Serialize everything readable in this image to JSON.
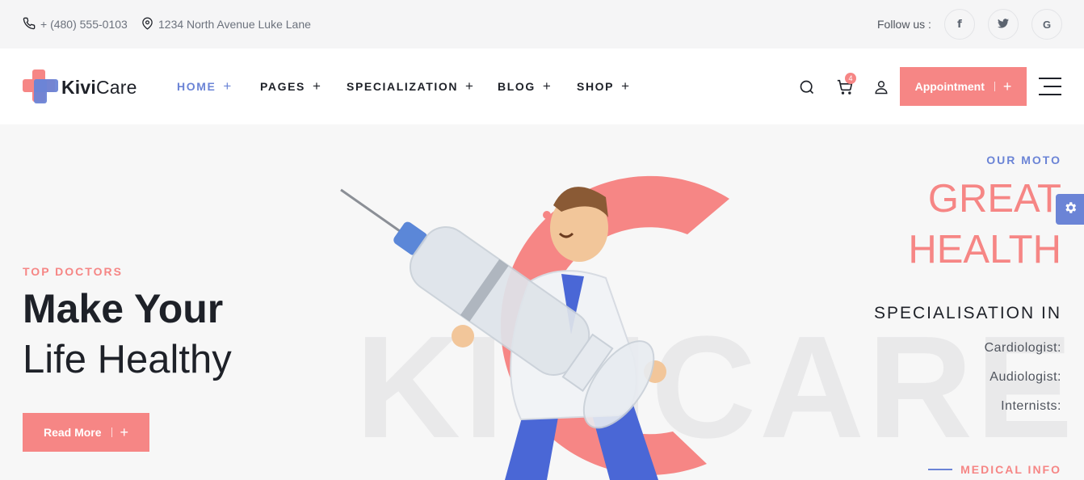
{
  "topbar": {
    "phone": "+ (480) 555-0103",
    "address": "1234 North Avenue Luke Lane",
    "follow_label": "Follow us :",
    "social": [
      {
        "icon": "facebook-icon",
        "glyph": "f"
      },
      {
        "icon": "twitter-icon",
        "glyph": "t"
      },
      {
        "icon": "google-icon",
        "glyph": "G"
      }
    ]
  },
  "header": {
    "logo_bold": "Kivi",
    "logo_regular": "Care",
    "nav": [
      {
        "label": "HOME",
        "active": true
      },
      {
        "label": "PAGES",
        "active": false
      },
      {
        "label": "SPECIALIZATION",
        "active": false
      },
      {
        "label": "BLOG",
        "active": false
      },
      {
        "label": "SHOP",
        "active": false
      }
    ],
    "nav_plus": "+",
    "cart_count": "4",
    "appointment_label": "Appointment",
    "appointment_plus": "+"
  },
  "hero": {
    "watermark": "KIVICARE",
    "eyebrow": "TOP DOCTORS",
    "title_line1": "Make Your",
    "title_line2": "Life Healthy",
    "read_more_label": "Read More",
    "read_more_plus": "+",
    "moto_label": "OUR MOTO",
    "moto_line1": "GREAT",
    "moto_line2": "HEALTH",
    "specialisation_heading": "SPECIALISATION IN",
    "specialisations": [
      "Cardiologist:",
      "Audiologist:",
      "Internists:"
    ],
    "medical_info_label": "MEDICAL INFO"
  },
  "colors": {
    "accent_pink": "#f68685",
    "accent_blue": "#6b84d6",
    "text_dark": "#1e2128",
    "background": "#f7f7f7"
  }
}
